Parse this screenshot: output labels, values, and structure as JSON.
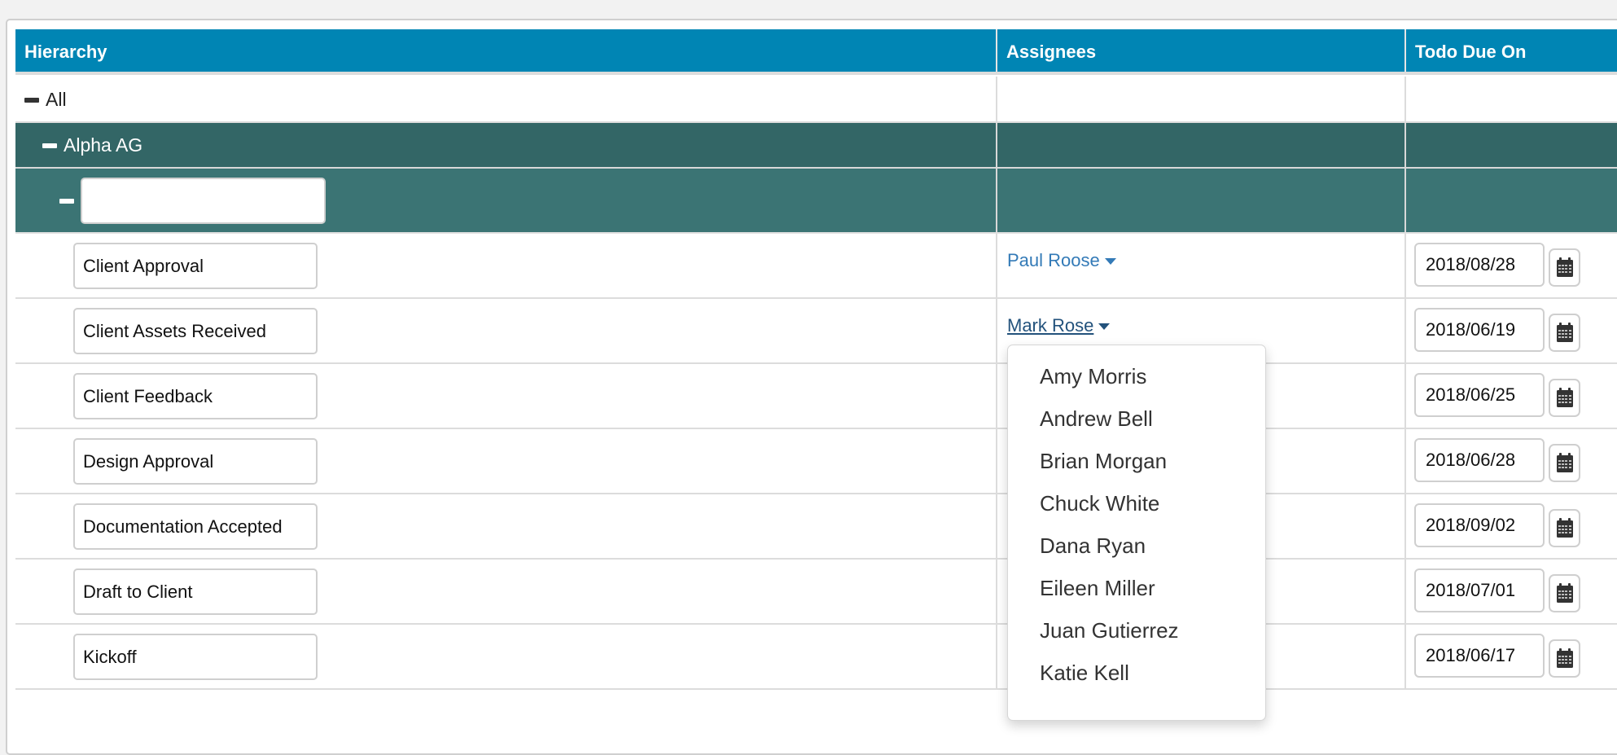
{
  "table": {
    "columns": [
      {
        "label": "Hierarchy"
      },
      {
        "label": "Assignees"
      },
      {
        "label": "Todo Due On"
      }
    ],
    "tree": {
      "root_label": "All",
      "group_label": "Alpha AG",
      "new_item_input": {
        "value": "",
        "placeholder": ""
      }
    },
    "rows": [
      {
        "name": "Client Approval",
        "assignee": "Paul Roose",
        "due": "2018/08/28"
      },
      {
        "name": "Client Assets Received",
        "assignee": "Mark Rose",
        "due": "2018/06/19"
      },
      {
        "name": "Client Feedback",
        "assignee": "",
        "due": "2018/06/25"
      },
      {
        "name": "Design Approval",
        "assignee": "",
        "due": "2018/06/28"
      },
      {
        "name": "Documentation Accepted",
        "assignee": "",
        "due": "2018/09/02"
      },
      {
        "name": "Draft to Client",
        "assignee": "",
        "due": "2018/07/01"
      },
      {
        "name": "Kickoff",
        "assignee": "",
        "due": "2018/06/17"
      }
    ]
  },
  "assignee_dropdown": {
    "open_for": "Mark Rose",
    "options": [
      "Amy Morris",
      "Andrew Bell",
      "Brian Morgan",
      "Chuck White",
      "Dana Ryan",
      "Eileen Miller",
      "Juan Gutierrez",
      "Katie Kell"
    ]
  },
  "icons": {
    "collapse": "minus-icon",
    "dropdown": "caret-down-icon",
    "date_picker": "calendar-icon"
  },
  "colors": {
    "header_bg": "#0085b4",
    "group_row_bg": "#336666",
    "subgroup_row_bg": "#3b7474",
    "link": "#337ab7",
    "link_active": "#23527c"
  }
}
